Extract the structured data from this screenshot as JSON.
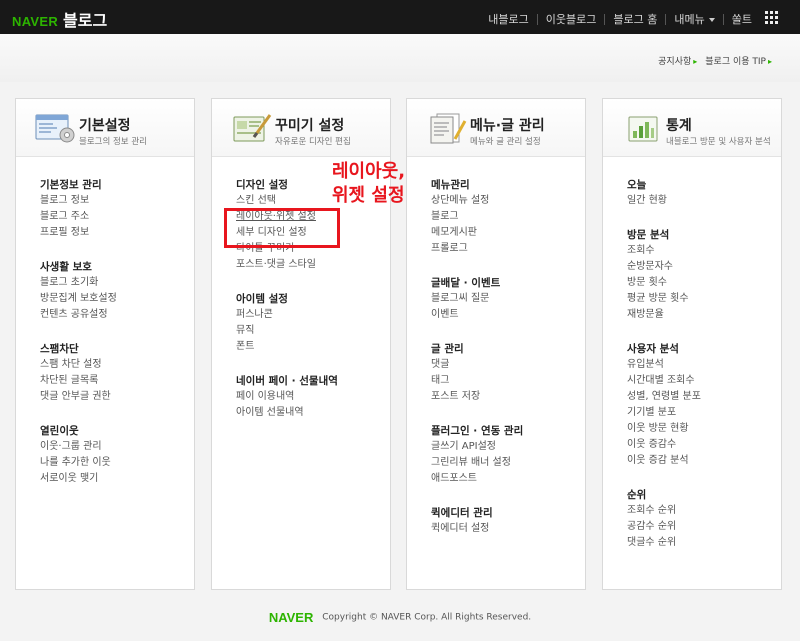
{
  "topbar": {
    "brand": "NAVER",
    "title": "블로그",
    "nav": [
      "내블로그",
      "이웃블로그",
      "블로그 홈",
      "내메뉴",
      "쏠트"
    ],
    "menu_caret_index": 3
  },
  "utility": {
    "notice": "공지사항",
    "tip": "블로그 이용 TIP"
  },
  "cards": [
    {
      "title": "기본설정",
      "subtitle": "블로그의 정보 관리",
      "icon": "settings-window-icon",
      "sections": [
        {
          "title": "기본정보 관리",
          "items": [
            "블로그 정보",
            "블로그 주소",
            "프로필 정보"
          ]
        },
        {
          "title": "사생활 보호",
          "items": [
            "블로그 초기화",
            "방문집계 보호설정",
            "컨텐츠 공유설정"
          ]
        },
        {
          "title": "스팸차단",
          "items": [
            "스팸 차단 설정",
            "차단된 글목록",
            "댓글 안부글 권한"
          ]
        },
        {
          "title": "열린이웃",
          "items": [
            "이웃·그룹 관리",
            "나를 추가한 이웃",
            "서로이웃 맺기"
          ]
        }
      ]
    },
    {
      "title": "꾸미기 설정",
      "subtitle": "자유로운 디자인 편집",
      "icon": "design-brush-icon",
      "sections": [
        {
          "title": "디자인 설정",
          "items": [
            "스킨 선택",
            "레이아웃·위젯 설정",
            "세부 디자인 설정",
            "타이틀 꾸미기",
            "포스트·댓글 스타일"
          ]
        },
        {
          "title": "아이템 설정",
          "items": [
            "퍼스나콘",
            "뮤직",
            "폰트"
          ]
        },
        {
          "title": "네이버 페이 · 선물내역",
          "items": [
            "페이 이용내역",
            "아이템 선물내역"
          ]
        }
      ]
    },
    {
      "title": "메뉴·글 관리",
      "subtitle": "메뉴와 글 관리 설정",
      "icon": "document-list-icon",
      "sections": [
        {
          "title": "메뉴관리",
          "items": [
            "상단메뉴 설정",
            "블로그",
            "메모게시판",
            "프롤로그"
          ]
        },
        {
          "title": "글배달 · 이벤트",
          "items": [
            "블로그씨 질문",
            "이벤트"
          ]
        },
        {
          "title": "글 관리",
          "items": [
            "댓글",
            "태그",
            "포스트 저장"
          ]
        },
        {
          "title": "플러그인 · 연동 관리",
          "items": [
            "글쓰기 API설정",
            "그린리뷰 배너 설정",
            "애드포스트"
          ]
        },
        {
          "title": "퀵에디터 관리",
          "items": [
            "퀵에디터 설정"
          ]
        }
      ]
    },
    {
      "title": "통계",
      "subtitle": "내블로그 방문 및 사용자 분석",
      "icon": "stats-chart-icon",
      "sections": [
        {
          "title": "오늘",
          "items": [
            "일간 현황"
          ]
        },
        {
          "title": "방문 분석",
          "items": [
            "조회수",
            "순방문자수",
            "방문 횟수",
            "평균 방문 횟수",
            "재방문율"
          ]
        },
        {
          "title": "사용자 분석",
          "items": [
            "유입분석",
            "시간대별 조회수",
            "성별, 연령별 분포",
            "기기별 분포",
            "이웃 방문 현황",
            "이웃 증감수",
            "이웃 증감 분석"
          ]
        },
        {
          "title": "순위",
          "items": [
            "조회수 순위",
            "공감수 순위",
            "댓글수 순위"
          ]
        }
      ]
    }
  ],
  "annotation": {
    "line1": "레이아웃,",
    "line2": "위젯 설정"
  },
  "footer": {
    "brand": "NAVER",
    "copyright": "Copyright © NAVER Corp. All Rights Reserved."
  },
  "colors": {
    "brand_green": "#2db400",
    "annotation_red": "#e8161e",
    "topbar_bg": "#181818"
  }
}
